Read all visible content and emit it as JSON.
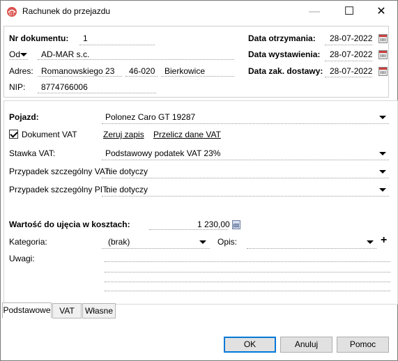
{
  "window": {
    "title": "Rachunek do przejazdu",
    "minimize": "—",
    "maximize": "☐",
    "close": "✕"
  },
  "header": {
    "doc_no_label": "Nr dokumentu:",
    "doc_no": "1",
    "od_label": "Od",
    "contractor": "AD-MAR s.c.",
    "address_label": "Adres:",
    "street": "Romanowskiego 23",
    "postcode": "46-020",
    "city": "Bierkowice",
    "nip_label": "NIP:",
    "nip": "8774766006",
    "received_label": "Data otrzymania:",
    "received": "28-07-2022",
    "issued_label": "Data wystawienia:",
    "issued": "28-07-2022",
    "delivery_label": "Data zak. dostawy:",
    "delivery": "28-07-2022"
  },
  "main": {
    "vehicle_label": "Pojazd:",
    "vehicle": "Polonez Caro GT 19287",
    "vat_doc_label": "Dokument VAT",
    "vat_doc_checked": true,
    "reset_link": "Zeruj zapis",
    "recalc_link": "Przelicz dane VAT",
    "vat_rate_label": "Stawka VAT:",
    "vat_rate": "Podstawowy podatek VAT 23%",
    "special_vat_label": "Przypadek szczególny VAT:",
    "special_vat": "nie dotyczy",
    "special_pit_label": "Przypadek szczególny PIT:",
    "special_pit": "nie dotyczy",
    "cost_label": "Wartość do ujęcia w kosztach:",
    "cost": "1 230,00",
    "category_label": "Kategoria:",
    "category": "(brak)",
    "desc_label": "Opis:",
    "desc": "",
    "add": "+",
    "notes_label": "Uwagi:"
  },
  "tabs": [
    "Podstawowe",
    "VAT",
    "Własne"
  ],
  "buttons": {
    "ok": "OK",
    "cancel": "Anuluj",
    "help": "Pomoc"
  }
}
